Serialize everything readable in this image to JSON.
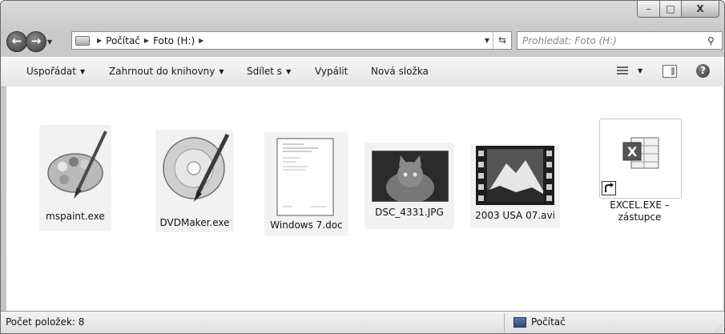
{
  "window": {
    "min_label": "–",
    "max_label": "□",
    "close_label": "X"
  },
  "address": {
    "crumbs": [
      "Počítač",
      "Foto (H:)"
    ],
    "search_placeholder": "Prohledat: Foto (H:)"
  },
  "toolbar": {
    "organize": "Uspořádat",
    "include": "Zahrnout do knihovny",
    "share": "Sdílet s",
    "burn": "Vypálit",
    "new_folder": "Nová složka"
  },
  "files": [
    {
      "name": "mspaint.exe",
      "icon": "paint-palette-icon"
    },
    {
      "name": "DVDMaker.exe",
      "icon": "dvd-maker-icon"
    },
    {
      "name": "Windows 7.doc",
      "icon": "document-icon"
    },
    {
      "name": "DSC_4331.JPG",
      "icon": "cat-photo-icon"
    },
    {
      "name": "2003 USA 07.avi",
      "icon": "video-film-icon"
    },
    {
      "name": "EXCEL.EXE – zástupce",
      "icon": "excel-shortcut-icon"
    }
  ],
  "status": {
    "count": "Počet položek: 8",
    "location": "Počítač"
  }
}
